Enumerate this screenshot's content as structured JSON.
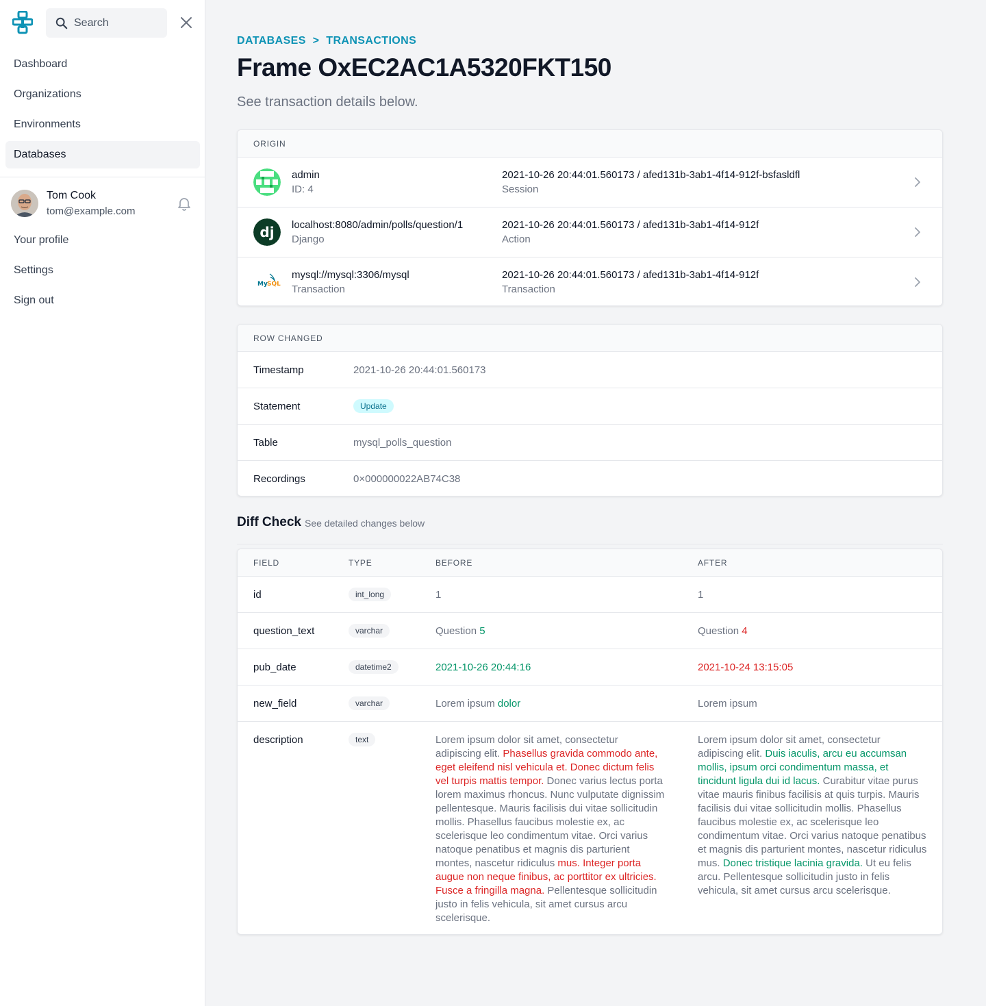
{
  "sidebar": {
    "search_placeholder": "Search",
    "nav": [
      {
        "label": "Dashboard"
      },
      {
        "label": "Organizations"
      },
      {
        "label": "Environments"
      },
      {
        "label": "Databases"
      }
    ],
    "user": {
      "name": "Tom Cook",
      "email": "tom@example.com"
    },
    "user_nav": [
      {
        "label": "Your profile"
      },
      {
        "label": "Settings"
      },
      {
        "label": "Sign out"
      }
    ]
  },
  "header": {
    "breadcrumb": [
      "DATABASES",
      ">",
      "TRANSACTIONS"
    ],
    "title": "Frame OxEC2AC1A5320FKT150",
    "subtitle": "See transaction details below."
  },
  "origin": {
    "heading": "ORIGIN",
    "rows": [
      {
        "name": "admin",
        "sub": "ID: 4",
        "meta": "2021-10-26 20:44:01.560173 / afed131b-3ab1-4f14-912f-bsfasldfl",
        "kind": "Session"
      },
      {
        "name": "localhost:8080/admin/polls/question/1",
        "sub": "Django",
        "meta": "2021-10-26 20:44:01.560173 / afed131b-3ab1-4f14-912f",
        "kind": "Action"
      },
      {
        "name": "mysql://mysql:3306/mysql",
        "sub": "Transaction",
        "meta": "2021-10-26 20:44:01.560173 / afed131b-3ab1-4f14-912f",
        "kind": "Transaction"
      }
    ]
  },
  "row_changed": {
    "heading": "ROW CHANGED",
    "rows": [
      {
        "label": "Timestamp",
        "value": "2021-10-26 20:44:01.560173"
      },
      {
        "label": "Statement",
        "value": "Update"
      },
      {
        "label": "Table",
        "value": "mysql_polls_question"
      },
      {
        "label": "Recordings",
        "value": "0×000000022AB74C38"
      }
    ]
  },
  "diff": {
    "title": "Diff Check",
    "subtitle": "See detailed changes below",
    "columns": [
      "FIELD",
      "TYPE",
      "BEFORE",
      "AFTER"
    ],
    "rows": [
      {
        "field": "id",
        "type": "int_long",
        "before": "1",
        "after": "1"
      },
      {
        "field": "question_text",
        "type": "varchar",
        "before_plain": "Question ",
        "before_hl": "5",
        "after_plain": "Question ",
        "after_hl": "4"
      },
      {
        "field": "pub_date",
        "type": "datetime2",
        "before": "2021-10-26 20:44:16",
        "after": "2021-10-24 13:15:05"
      },
      {
        "field": "new_field",
        "type": "varchar",
        "before_plain": "Lorem ipsum ",
        "before_hl": "dolor",
        "after": "Lorem ipsum"
      },
      {
        "field": "description",
        "type": "text",
        "before": [
          {
            "t": "Lorem ipsum dolor sit amet, consectetur adipiscing elit. ",
            "s": "plain"
          },
          {
            "t": "Phasellus gravida commodo ante, eget eleifend nisl vehicula et. Donec dictum felis vel turpis mattis tempor.",
            "s": "red"
          },
          {
            "t": " Donec varius lectus porta lorem maximus rhoncus. Nunc vulputate dignissim pellentesque. Mauris facilisis dui vitae sollicitudin mollis. Phasellus faucibus molestie ex, ac scelerisque leo condimentum vitae. Orci varius natoque penatibus et magnis dis parturient montes, nascetur ridiculus ",
            "s": "plain"
          },
          {
            "t": "mus. Integer porta augue non neque finibus, ac porttitor ex ultricies. Fusce a fringilla magna.",
            "s": "red"
          },
          {
            "t": " Pellentesque sollicitudin justo in felis vehicula, sit amet cursus arcu scelerisque.",
            "s": "plain"
          }
        ],
        "after": [
          {
            "t": "Lorem ipsum dolor sit amet, consectetur adipiscing elit. ",
            "s": "plain"
          },
          {
            "t": "Duis iaculis, arcu eu accumsan mollis, ipsum orci condimentum massa, et tincidunt ligula dui id lacus.",
            "s": "green"
          },
          {
            "t": " Curabitur vitae purus vitae mauris finibus facilisis at quis turpis. Mauris facilisis dui vitae sollicitudin mollis. Phasellus faucibus molestie ex, ac scelerisque leo condimentum vitae. Orci varius natoque penatibus et magnis dis parturient montes, nascetur ridiculus mus. ",
            "s": "plain"
          },
          {
            "t": "Donec tristique lacinia gravida.",
            "s": "green"
          },
          {
            "t": " Ut eu felis arcu. Pellentesque sollicitudin justo in felis vehicula, sit amet cursus arcu scelerisque.",
            "s": "plain"
          }
        ]
      }
    ]
  },
  "colors": {
    "accent": "#0e93b5",
    "added": "#059669",
    "removed": "#dc2626",
    "badge_bg": "#cffafe"
  }
}
